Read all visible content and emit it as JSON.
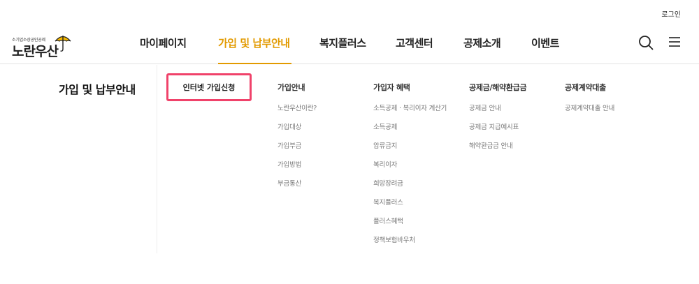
{
  "topbar": {
    "login_label": "로그인"
  },
  "logo": {
    "small_text": "소기업소상공인공제",
    "main_text": "노란우산"
  },
  "gnb": {
    "items": [
      {
        "label": "마이페이지"
      },
      {
        "label": "가입 및 납부안내"
      },
      {
        "label": "복지플러스"
      },
      {
        "label": "고객센터"
      },
      {
        "label": "공제소개"
      },
      {
        "label": "이벤트"
      }
    ],
    "active_index": 1
  },
  "mega": {
    "title": "가입 및 납부안내",
    "apply_button": "인터넷 가입신청",
    "columns": [
      {
        "heading": "가입안내",
        "items": [
          "노란우산이란?",
          "가입대상",
          "가입부금",
          "가입방법",
          "부금통산"
        ]
      },
      {
        "heading": "가입자 혜택",
        "items": [
          "소득공제 · 복리이자 계산기",
          "소득공제",
          "압류금지",
          "복리이자",
          "희망장려금",
          "복지플러스",
          "플러스혜택",
          "정책보험바우처"
        ]
      },
      {
        "heading": "공제금/해약환급금",
        "items": [
          "공제금 안내",
          "공제금 지급예시표",
          "해약환급금 안내"
        ]
      },
      {
        "heading": "공제계약대출",
        "items": [
          "공제계약대출 안내"
        ]
      }
    ]
  },
  "colors": {
    "accent": "#e29a00",
    "highlight_border": "#f0426a"
  },
  "icons": {
    "search": "search-icon",
    "menu": "hamburger-menu-icon",
    "logo": "umbrella-icon"
  }
}
